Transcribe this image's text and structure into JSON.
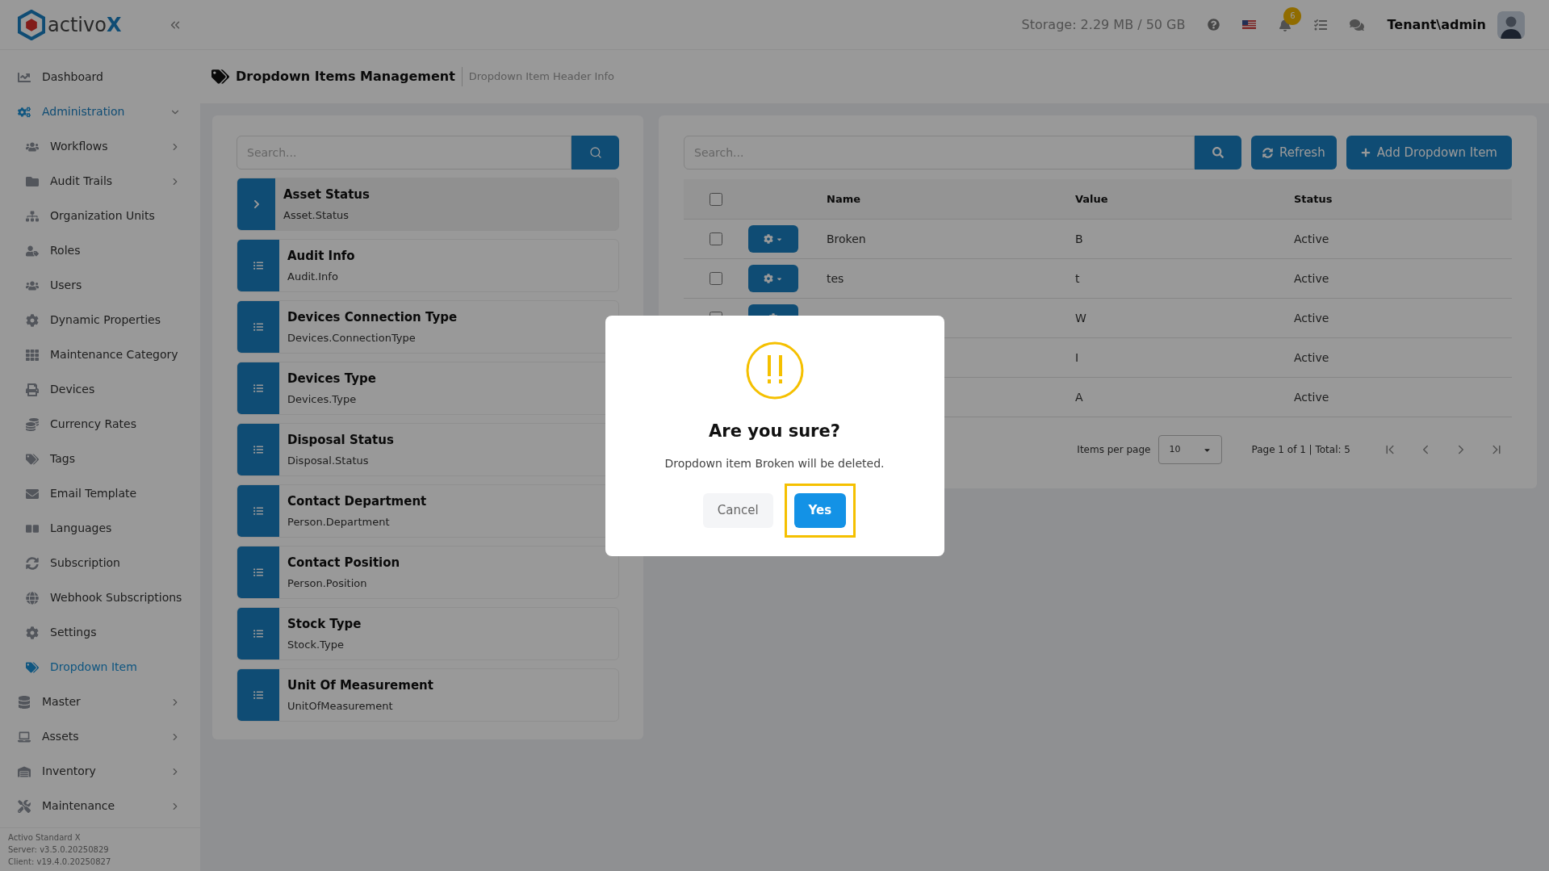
{
  "header": {
    "logo": "activo",
    "logo_mark": "X",
    "storage": "Storage: 2.29 MB / 50 GB",
    "notifications": "6",
    "user": "Tenant\\admin"
  },
  "sidebar": {
    "items": [
      {
        "label": "Dashboard",
        "selected": false
      },
      {
        "label": "Administration",
        "selected": false,
        "expanded": true,
        "children": [
          {
            "label": "Workflows",
            "selected": false,
            "expanded": false
          },
          {
            "label": "Audit Trails",
            "selected": false,
            "expanded": false
          },
          {
            "label": "Organization Units",
            "selected": false
          },
          {
            "label": "Roles",
            "selected": false
          },
          {
            "label": "Users",
            "selected": false
          },
          {
            "label": "Dynamic Properties",
            "selected": false
          },
          {
            "label": "Maintenance Category",
            "selected": false
          },
          {
            "label": "Devices",
            "selected": false
          },
          {
            "label": "Currency Rates",
            "selected": false
          },
          {
            "label": "Tags",
            "selected": false
          },
          {
            "label": "Email Template",
            "selected": false
          },
          {
            "label": "Languages",
            "selected": false
          },
          {
            "label": "Subscription",
            "selected": false
          },
          {
            "label": "Webhook Subscriptions",
            "selected": false
          },
          {
            "label": "Settings",
            "selected": false
          },
          {
            "label": "Dropdown Item",
            "selected": true
          }
        ]
      },
      {
        "label": "Master",
        "selected": false,
        "expanded": false
      },
      {
        "label": "Assets",
        "selected": false,
        "expanded": false
      },
      {
        "label": "Inventory",
        "selected": false,
        "expanded": false
      },
      {
        "label": "Maintenance",
        "selected": false,
        "expanded": false
      }
    ],
    "footer": [
      "Activo Standard X",
      "Server: v3.5.0.20250829",
      "Client: v19.4.0.20250827"
    ]
  },
  "breadcrumb": {
    "title": "Dropdown Items Management",
    "subtitle": "Dropdown Item Header Info"
  },
  "list_panel": {
    "search": {
      "placeholder": "Search..."
    },
    "items": [
      {
        "title": "Asset Status",
        "code": "Asset.Status",
        "selected": true
      },
      {
        "title": "Audit Info",
        "code": "Audit.Info",
        "selected": false
      },
      {
        "title": "Devices Connection Type",
        "code": "Devices.ConnectionType",
        "selected": false
      },
      {
        "title": "Devices Type",
        "code": "Devices.Type",
        "selected": false
      },
      {
        "title": "Disposal Status",
        "code": "Disposal.Status",
        "selected": false
      },
      {
        "title": "Contact Department",
        "code": "Person.Department",
        "selected": false
      },
      {
        "title": "Contact Position",
        "code": "Person.Position",
        "selected": false
      },
      {
        "title": "Stock Type",
        "code": "Stock.Type",
        "selected": false
      },
      {
        "title": "Unit Of Measurement",
        "code": "UnitOfMeasurement",
        "selected": false
      }
    ]
  },
  "table_panel": {
    "search": {
      "placeholder": "Search..."
    },
    "buttons": [
      "Refresh",
      "Add Dropdown Item"
    ],
    "columns": [
      "Name",
      "Value",
      "Status"
    ],
    "header_checked": false,
    "rows": [
      {
        "name": "Broken",
        "value": "B",
        "status": "Active",
        "checked": false
      },
      {
        "name": "tes",
        "value": "t",
        "status": "Active",
        "checked": false
      },
      {
        "value": "W",
        "status": "Active",
        "checked": false
      },
      {
        "value": "I",
        "status": "Active"
      },
      {
        "value": "A",
        "status": "Active"
      }
    ],
    "pager": {
      "label": "Items per page",
      "page_size": "10",
      "summary": "Page 1 of 1 | Total: 5"
    }
  },
  "dialog": {
    "title": "Are you sure?",
    "message": "Dropdown item Broken will be deleted.",
    "buttons": [
      {
        "label": "Cancel",
        "kind": "secondary",
        "highlighted": false
      },
      {
        "label": "Yes",
        "kind": "primary",
        "highlighted": true
      }
    ]
  }
}
